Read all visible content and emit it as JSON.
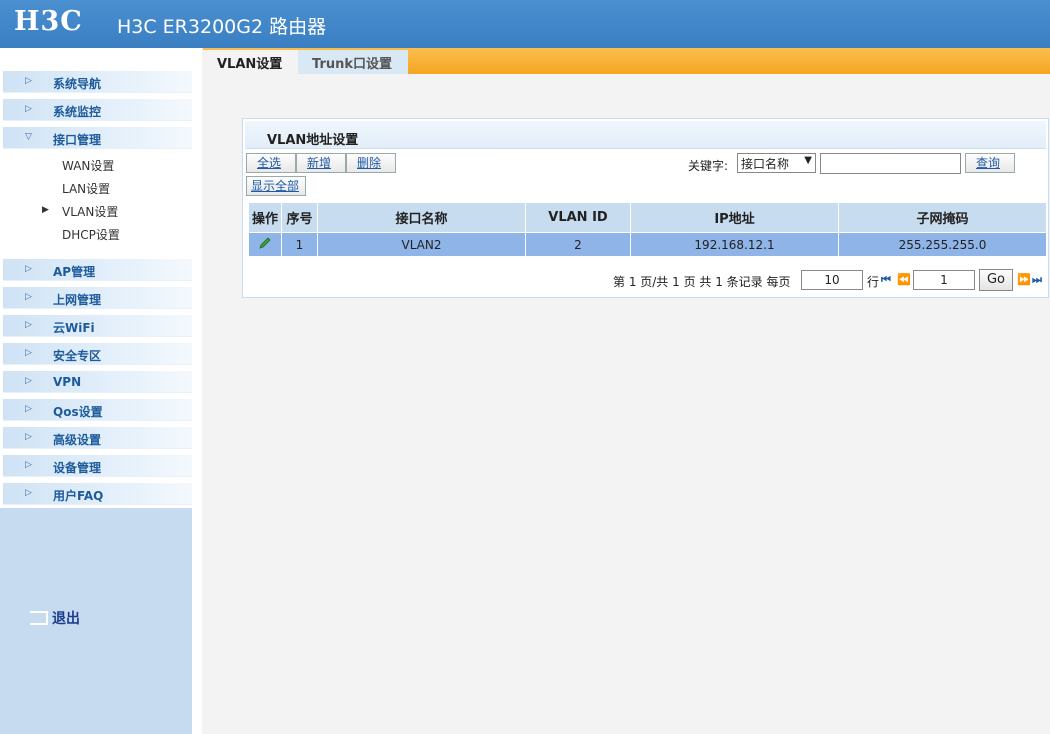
{
  "header": {
    "logo": "H3C",
    "title": "H3C ER3200G2 路由器"
  },
  "sidebar": {
    "items": [
      {
        "label": "系统导航"
      },
      {
        "label": "系统监控"
      },
      {
        "label": "接口管理",
        "expanded": true,
        "children": [
          "WAN设置",
          "LAN设置",
          "VLAN设置",
          "DHCP设置"
        ]
      },
      {
        "label": "AP管理"
      },
      {
        "label": "上网管理"
      },
      {
        "label": "云WiFi"
      },
      {
        "label": "安全专区"
      },
      {
        "label": "VPN"
      },
      {
        "label": "Qos设置"
      },
      {
        "label": "高级设置"
      },
      {
        "label": "设备管理"
      },
      {
        "label": "用户FAQ"
      }
    ],
    "logout": "退出"
  },
  "tabs": [
    {
      "label": "VLAN设置",
      "active": true
    },
    {
      "label": "Trunk口设置",
      "active": false
    }
  ],
  "panel": {
    "title": "VLAN地址设置",
    "buttons": {
      "select_all": "全选",
      "add": "新增",
      "delete": "删除",
      "show_all": "显示全部",
      "query": "查询"
    },
    "keyword_label": "关键字:",
    "keyword_select": "接口名称",
    "table": {
      "columns": [
        "操作",
        "序号",
        "接口名称",
        "VLAN ID",
        "IP地址",
        "子网掩码"
      ],
      "rows": [
        {
          "index": "1",
          "name": "VLAN2",
          "vlan_id": "2",
          "ip": "192.168.12.1",
          "mask": "255.255.255.0"
        }
      ]
    },
    "pager": {
      "summary": "第 1 页/共 1 页 共 1 条记录 每页",
      "per_page": "10",
      "row_unit": "行",
      "page": "1",
      "go": "Go"
    }
  },
  "colors": {
    "header": "#3a7fc2",
    "tab_bar": "#f5a623",
    "selected_row": "#8fb4e8"
  }
}
